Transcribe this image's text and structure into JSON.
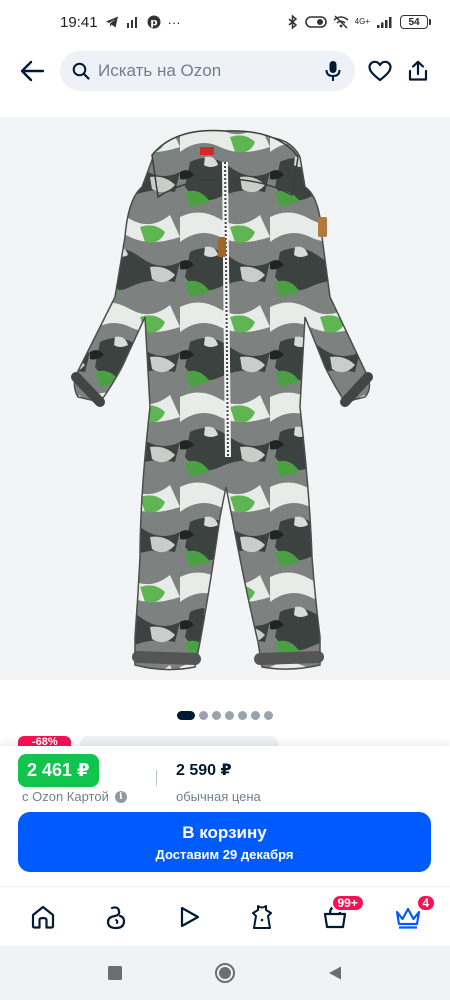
{
  "status_bar": {
    "time": "19:41",
    "battery": "54",
    "network": "4G+"
  },
  "header": {
    "search_placeholder": "Искать на Ozon"
  },
  "gallery": {
    "total_images": 7,
    "active_index": 0
  },
  "peek": {
    "discount_badge": "-68%"
  },
  "price": {
    "ozon_card_price": "2 461 ₽",
    "ozon_card_caption": "с Ozon Картой",
    "regular_price": "2 590 ₽",
    "regular_caption": "обычная цена"
  },
  "cart_button": {
    "title": "В корзину",
    "subtitle": "Доставим 29 декабря"
  },
  "tab_bar": {
    "items": [
      {
        "name": "home",
        "badge": ""
      },
      {
        "name": "premium",
        "badge": ""
      },
      {
        "name": "video",
        "badge": ""
      },
      {
        "name": "fashion",
        "badge": ""
      },
      {
        "name": "cart",
        "badge": "99+"
      },
      {
        "name": "profile",
        "badge": "4"
      }
    ]
  },
  "colors": {
    "brand_blue": "#005bff",
    "ozon_card_green": "#10c44c",
    "badge_pink": "#f91155",
    "text_primary": "#001a34",
    "text_secondary": "#707f8d"
  }
}
